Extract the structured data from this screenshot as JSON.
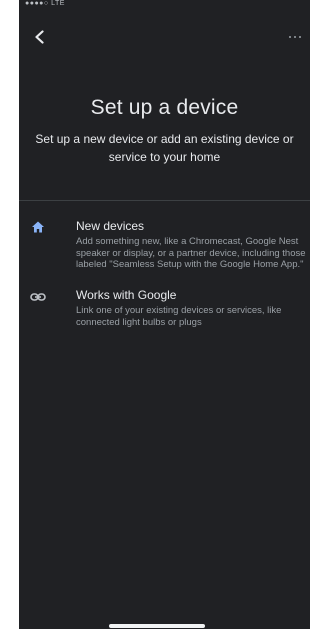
{
  "status_bar": {
    "carrier": "●●●●○ LTE"
  },
  "top_bar": {
    "back_icon": "chevron-left-icon",
    "more_icon": "more-horiz-icon"
  },
  "header": {
    "title": "Set up a device",
    "subtitle": "Set up a new device or add an existing device or service to your home"
  },
  "options": [
    {
      "icon": "home-icon",
      "title": "New devices",
      "description": "Add something new, like a Chromecast, Google Nest speaker or display, or a partner device, including those labeled \"Seamless Setup with the Google Home App.\""
    },
    {
      "icon": "link-icon",
      "title": "Works with Google",
      "description": "Link one of your existing devices or services, like connected light bulbs or plugs"
    }
  ],
  "colors": {
    "background": "#202124",
    "text_primary": "#e8eaed",
    "text_secondary": "#9aa0a6",
    "accent": "#8ab4f8"
  }
}
